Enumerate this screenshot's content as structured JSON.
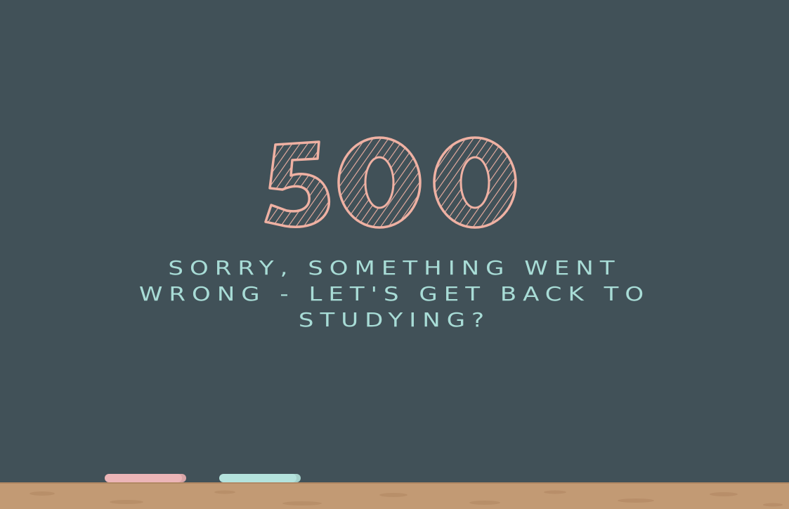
{
  "error": {
    "code": "500",
    "message": "Sorry, something went wrong - let's get back to studying?"
  },
  "colors": {
    "board": "#415158",
    "code": "#efb1a3",
    "message": "#a8dcd6",
    "tray": "#c29a74",
    "chalk_pink": "#ecb5b7",
    "chalk_blue": "#b4e3dd"
  }
}
